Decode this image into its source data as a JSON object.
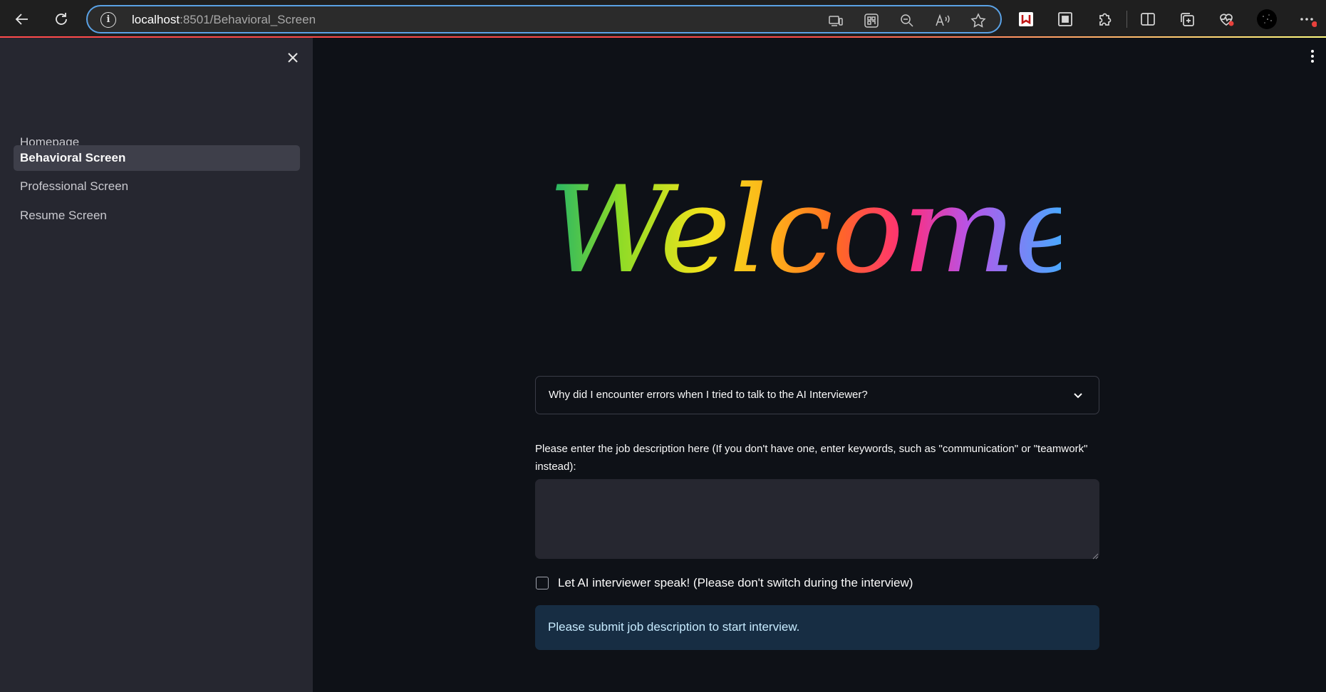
{
  "browser": {
    "url_host": "localhost",
    "url_path": ":8501/Behavioral_Screen",
    "info_symbol": "i"
  },
  "sidebar": {
    "items": [
      {
        "label": "Homepage",
        "active": false
      },
      {
        "label": "Behavioral Screen",
        "active": true
      },
      {
        "label": "Professional Screen",
        "active": false
      },
      {
        "label": "Resume Screen",
        "active": false
      }
    ]
  },
  "main": {
    "welcome_text": "Welcome",
    "expander_label": "Why did I encounter errors when I tried to talk to the AI Interviewer?",
    "job_description_label": "Please enter the job description here (If you don't have one, enter keywords, such as \"communication\" or \"teamwork\" instead):",
    "job_description_value": "",
    "speak_checkbox_label": "Let AI interviewer speak! (Please don't switch during the interview)",
    "speak_checkbox_checked": false,
    "info_message": "Please submit job description to start interview."
  },
  "colors": {
    "main_bg": "#0e1117",
    "sidebar_bg": "#262730",
    "active_item_bg": "#3e3f4a",
    "info_bg": "#172d43",
    "info_text": "#c7ebff",
    "address_border": "#5aa2e6"
  }
}
